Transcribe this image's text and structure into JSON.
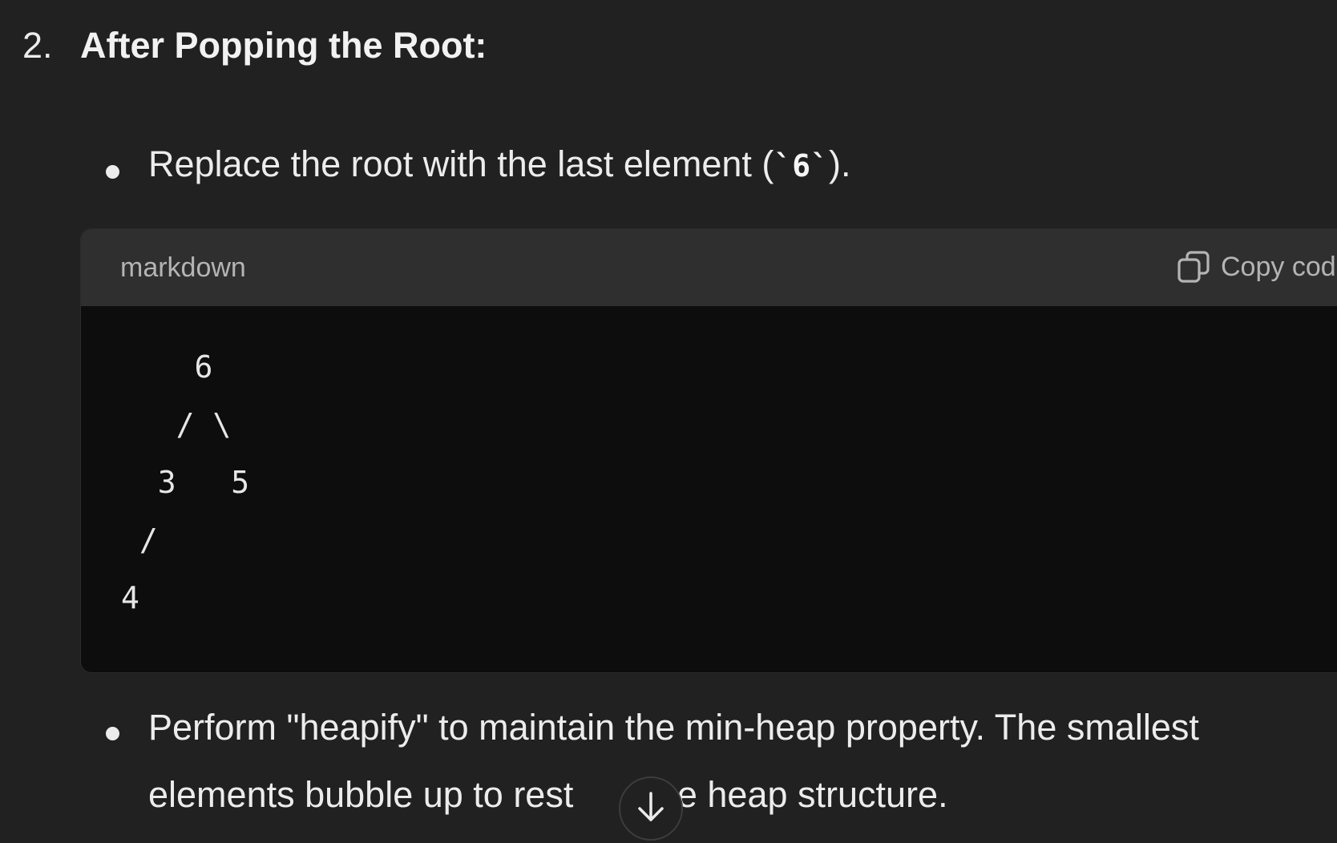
{
  "section": {
    "number": "2.",
    "title": "After Popping the Root:"
  },
  "bullets": [
    {
      "before": "Replace the root with the last element (",
      "code": "`6`",
      "after": ")."
    },
    {
      "line1": "Perform \"heapify\" to maintain the min-heap property. The smallest",
      "line2_a": "elements bubble up to rest",
      "line2_b": "the heap structure."
    }
  ],
  "code_block": {
    "language": "markdown",
    "copy_label": "Copy code",
    "content": "    6\n   / \\\n  3   5\n /\n4"
  },
  "icons": {
    "copy": "copy-icon",
    "scroll": "arrow-down-icon"
  }
}
